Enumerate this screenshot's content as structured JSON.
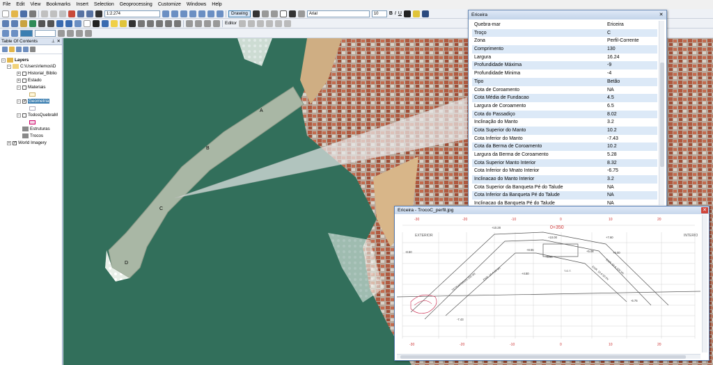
{
  "menu": [
    "File",
    "Edit",
    "View",
    "Bookmarks",
    "Insert",
    "Selection",
    "Geoprocessing",
    "Customize",
    "Windows",
    "Help"
  ],
  "toolbar": {
    "scale": "1:2.274",
    "drawing_label": "Drawing",
    "font_name": "Arial",
    "font_size": "10",
    "bold": "B",
    "italic": "I",
    "underline": "U",
    "editor_label": "Editor"
  },
  "toc": {
    "title": "Table Of Contents",
    "layers_label": "Layers",
    "folder": "C:\\Users\\rlemos\\D",
    "items": [
      {
        "label": "Historial_Biblio"
      },
      {
        "label": "Estado"
      },
      {
        "label": "Materiais"
      },
      {
        "label": "Geometria"
      },
      {
        "label": "TodosQuebraM"
      },
      {
        "label": "Estruturas"
      },
      {
        "label": "Trocos"
      },
      {
        "label": "World Imagery"
      }
    ]
  },
  "map": {
    "labels": [
      "A",
      "B",
      "C",
      "D"
    ]
  },
  "attributes": {
    "title": "Ericeira",
    "rows": [
      {
        "key": "Quebra-mar",
        "value": "Ericeira"
      },
      {
        "key": "Troço",
        "value": "C"
      },
      {
        "key": "Zona",
        "value": "Perfil-Corrente"
      },
      {
        "key": "Comprimento",
        "value": "130"
      },
      {
        "key": "Largura",
        "value": "16.24"
      },
      {
        "key": "Profundidade Máxima",
        "value": "-9"
      },
      {
        "key": "Profundidade Minima",
        "value": "-4"
      },
      {
        "key": "Tipo",
        "value": "Betão"
      },
      {
        "key": "Cota de Coroamento",
        "value": "NA"
      },
      {
        "key": "Cota Média de Fundacao",
        "value": "4.5"
      },
      {
        "key": "Largura de Coroamento",
        "value": "6.5"
      },
      {
        "key": "Cota do Passadiço",
        "value": "8.02"
      },
      {
        "key": "Inclinação do Manto",
        "value": "3.2"
      },
      {
        "key": "Cota Superior do Manto",
        "value": "10.2"
      },
      {
        "key": "Cota Inferior do Manto",
        "value": "-7.43"
      },
      {
        "key": "Cota da Berma de Coroamento",
        "value": "10.2"
      },
      {
        "key": "Largura da Berma de Coroamento",
        "value": "5.28"
      },
      {
        "key": "Cota Superior Manto Interior",
        "value": "8.32"
      },
      {
        "key": "Cota Inferior do Mnato Interior",
        "value": "-6.75"
      },
      {
        "key": "Inclinacao do Manto Interior",
        "value": "3.2"
      },
      {
        "key": "Cota Superior da Banqueta Pé do Talude",
        "value": "NA"
      },
      {
        "key": "Cota Inferior da Banqueta Pé do Talude",
        "value": "NA"
      },
      {
        "key": "Inclinacao da Banqueta Pé do Talude",
        "value": "NA"
      }
    ]
  },
  "image_window": {
    "title": "Ericeira - TrocoC_perfil.jpg",
    "station": "0+350",
    "exterior": "EXTERIOR",
    "interior": "INTERIO",
    "top_ticks": [
      "-30",
      "-20",
      "-10",
      "0",
      "10",
      "20"
    ],
    "bottom_ticks": [
      "-30",
      "-20",
      "-10",
      "0",
      "10",
      "20"
    ],
    "elevations": [
      "+10.28",
      "+8.55",
      "+10.00",
      "+7.60",
      "+5.08",
      "+5.00",
      "+6.00",
      "+4.50",
      "-6.75",
      "-7.43",
      "-8.50"
    ],
    "slope_labels": [
      "TETRAPODOS 200 kN",
      "ENR. 10 A 50 kN",
      "ENR. 50 A 100 kN",
      "ENR. 10 A 50 kN"
    ],
    "tot_label": "T.O.T."
  },
  "colors": {
    "sea": "#2f6b58",
    "breakwater": "#a9b7a5",
    "city_roof": "#b56a4f",
    "highlight": "#3c7fb1"
  }
}
